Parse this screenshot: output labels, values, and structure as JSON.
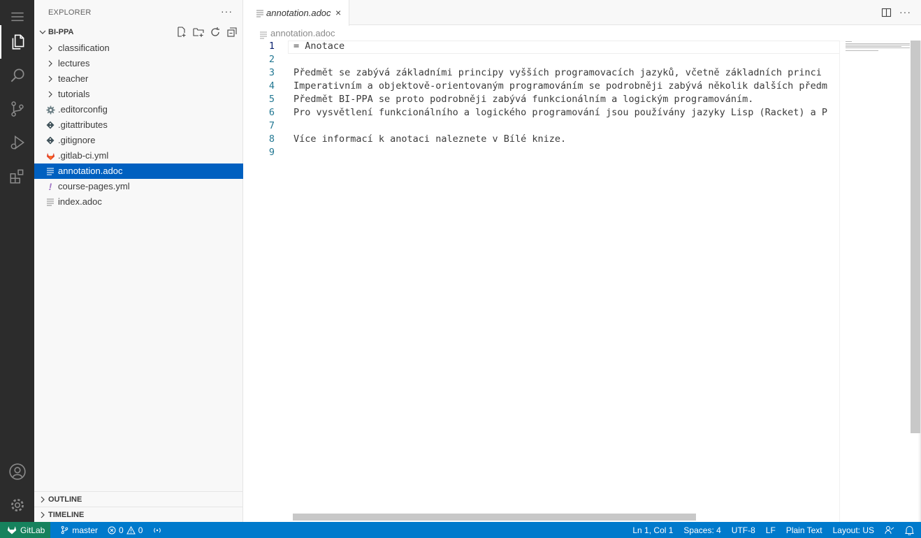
{
  "sidebar": {
    "header": "EXPLORER",
    "more": "···",
    "folder": "BI-PPA",
    "items": [
      {
        "label": "classification",
        "icon": "chevron-right-icon"
      },
      {
        "label": "lectures",
        "icon": "chevron-right-icon"
      },
      {
        "label": "teacher",
        "icon": "chevron-right-icon"
      },
      {
        "label": "tutorials",
        "icon": "chevron-right-icon"
      },
      {
        "label": ".editorconfig",
        "icon": "gear-icon"
      },
      {
        "label": ".gitattributes",
        "icon": "git-icon"
      },
      {
        "label": ".gitignore",
        "icon": "git-icon"
      },
      {
        "label": ".gitlab-ci.yml",
        "icon": "gitlab-icon"
      },
      {
        "label": "annotation.adoc",
        "icon": "lines-icon"
      },
      {
        "label": "course-pages.yml",
        "icon": "exclamation-icon"
      },
      {
        "label": "index.adoc",
        "icon": "lines-icon"
      }
    ],
    "outline": "OUTLINE",
    "timeline": "TIMELINE"
  },
  "tab": {
    "label": "annotation.adoc",
    "close": "×"
  },
  "breadcrumb": "annotation.adoc",
  "editor": {
    "lines": [
      {
        "num": "1",
        "text": "= Anotace"
      },
      {
        "num": "2",
        "text": ""
      },
      {
        "num": "3",
        "text": "Předmět se zabývá základními principy vyšších programovacích jazyků, včetně základních princi"
      },
      {
        "num": "4",
        "text": "Imperativním a objektově-orientovaným programováním se podrobněji zabývá několik dalších předm"
      },
      {
        "num": "5",
        "text": "Předmět BI-PPA se proto podrobněji zabývá funkcionálním a logickým programováním."
      },
      {
        "num": "6",
        "text": "Pro vysvětlení funkcionálního a logického programování jsou používány jazyky Lisp (Racket) a P"
      },
      {
        "num": "7",
        "text": ""
      },
      {
        "num": "8",
        "text": "Více informací k anotaci naleznete v Bílé knize."
      },
      {
        "num": "9",
        "text": ""
      }
    ]
  },
  "status": {
    "gitlab": "GitLab",
    "branch": "master",
    "errors": "0",
    "warnings": "0",
    "position": "Ln 1, Col 1",
    "spaces": "Spaces: 4",
    "encoding": "UTF-8",
    "eol": "LF",
    "language": "Plain Text",
    "layout": "Layout: US"
  },
  "colors": {
    "activity_bar": "#2c2c2c",
    "selection": "#0060c0",
    "status_bar": "#007acc",
    "gitlab_item": "#16825d"
  }
}
